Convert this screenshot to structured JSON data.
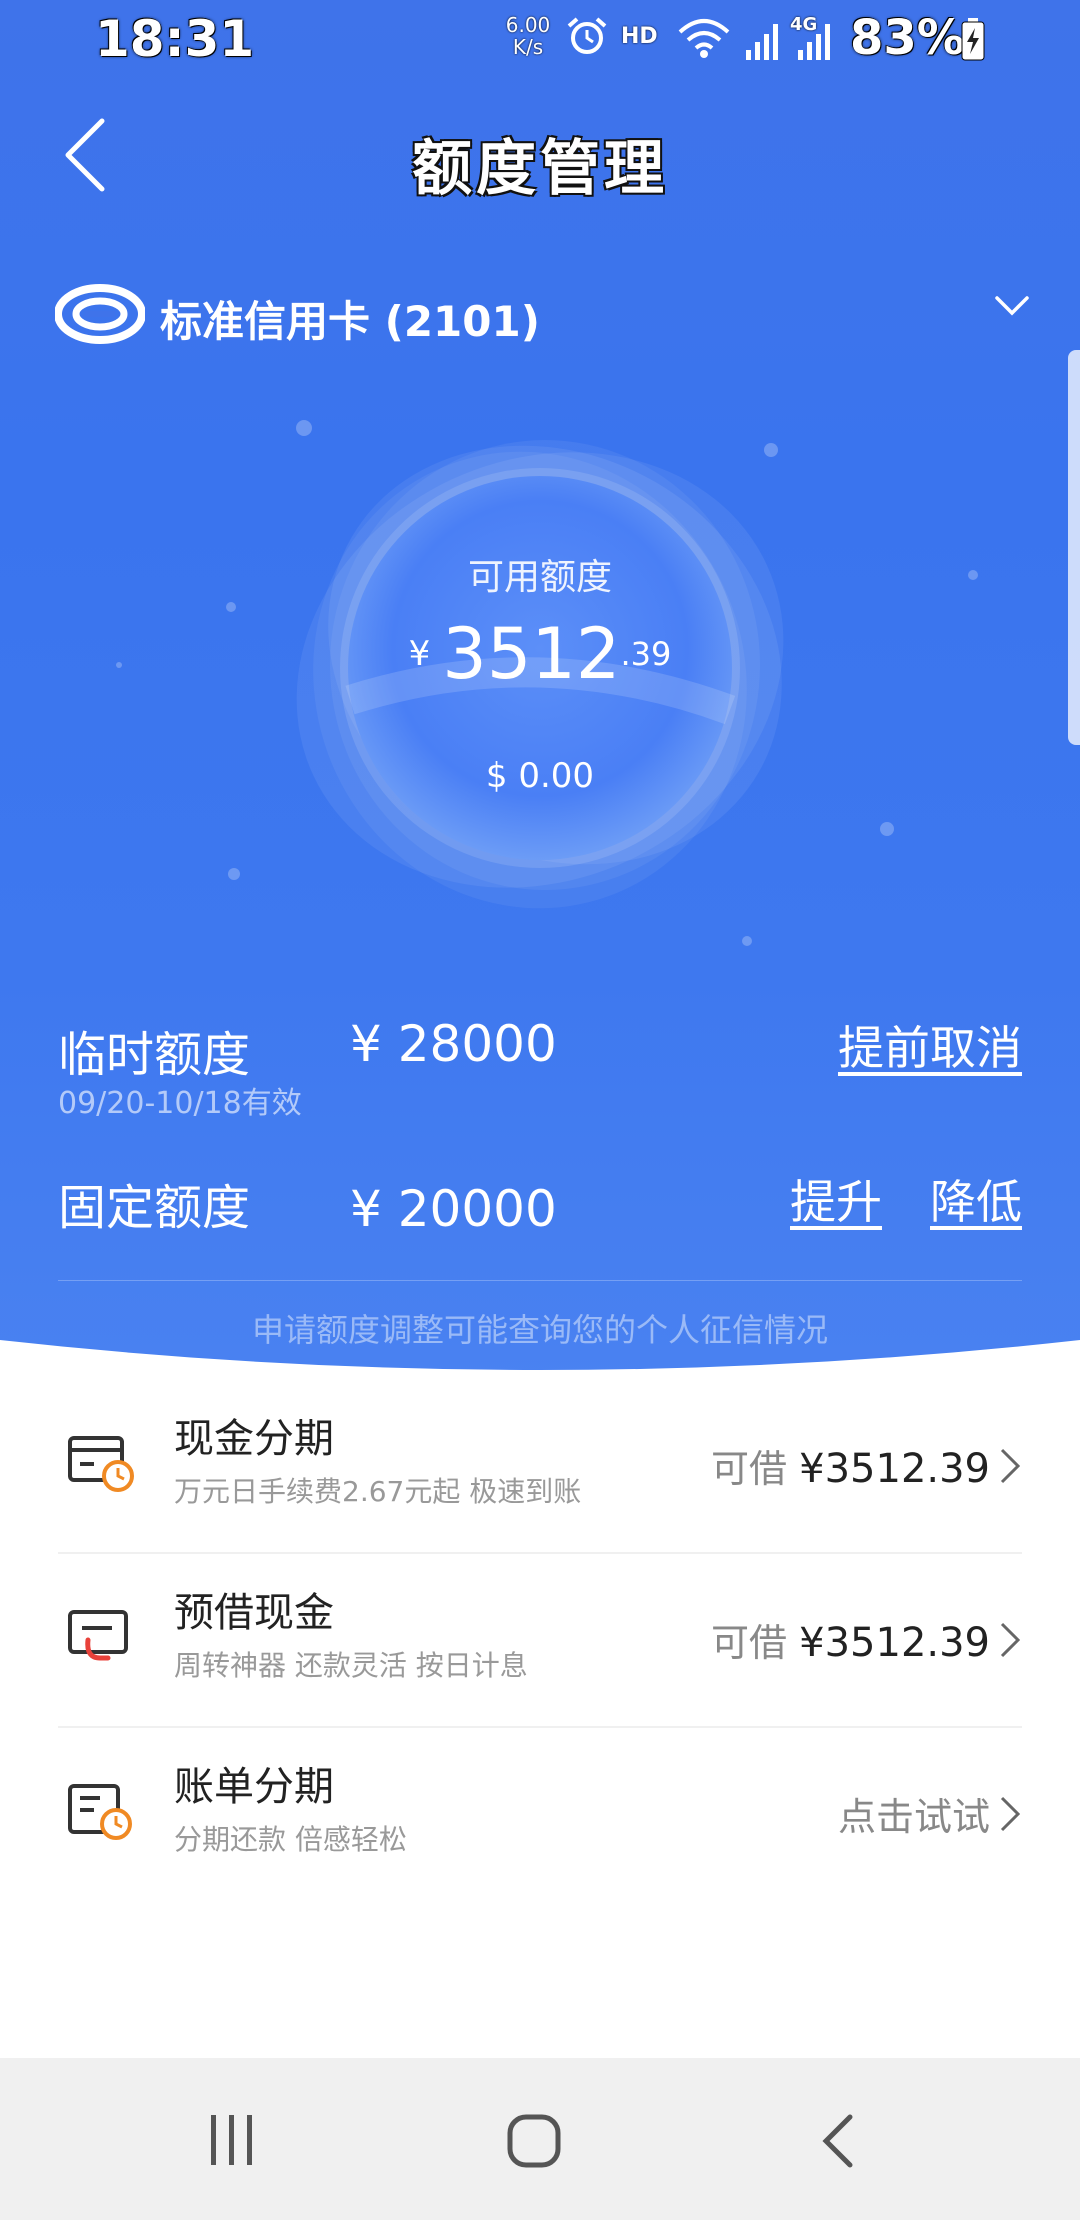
{
  "status_bar": {
    "time": "18:31",
    "net_speed_value": "6.00",
    "net_speed_unit": "K/s",
    "hd": "HD",
    "network": "4G",
    "battery": "83%"
  },
  "header": {
    "title": "额度管理"
  },
  "card": {
    "name": "标准信用卡 (2101)"
  },
  "available": {
    "label": "可用额度",
    "currency": "¥",
    "integer": "3512",
    "decimal": ".39",
    "usd": "$ 0.00"
  },
  "temporary": {
    "label": "临时额度",
    "validity": "09/20-10/18有效",
    "amount": "¥ 28000",
    "cancel_label": "提前取消"
  },
  "fixed": {
    "label": "固定额度",
    "amount": "¥ 20000",
    "raise_label": "提升",
    "lower_label": "降低"
  },
  "notice": "申请额度调整可能查询您的个人征信情况",
  "services": [
    {
      "title": "现金分期",
      "subtitle": "万元日手续费2.67元起 极速到账",
      "right_prefix": "可借",
      "right_amount": "¥3512.39",
      "icon": "cash-installment-icon"
    },
    {
      "title": "预借现金",
      "subtitle": "周转神器 还款灵活 按日计息",
      "right_prefix": "可借",
      "right_amount": "¥3512.39",
      "icon": "cash-advance-icon"
    },
    {
      "title": "账单分期",
      "subtitle": "分期还款 倍感轻松",
      "right_prefix": "点击试试",
      "right_amount": "",
      "icon": "bill-installment-icon"
    }
  ],
  "colors": {
    "primary_blue": "#3f73ea",
    "accent_orange": "#f08a24",
    "accent_red": "#e8413a"
  }
}
